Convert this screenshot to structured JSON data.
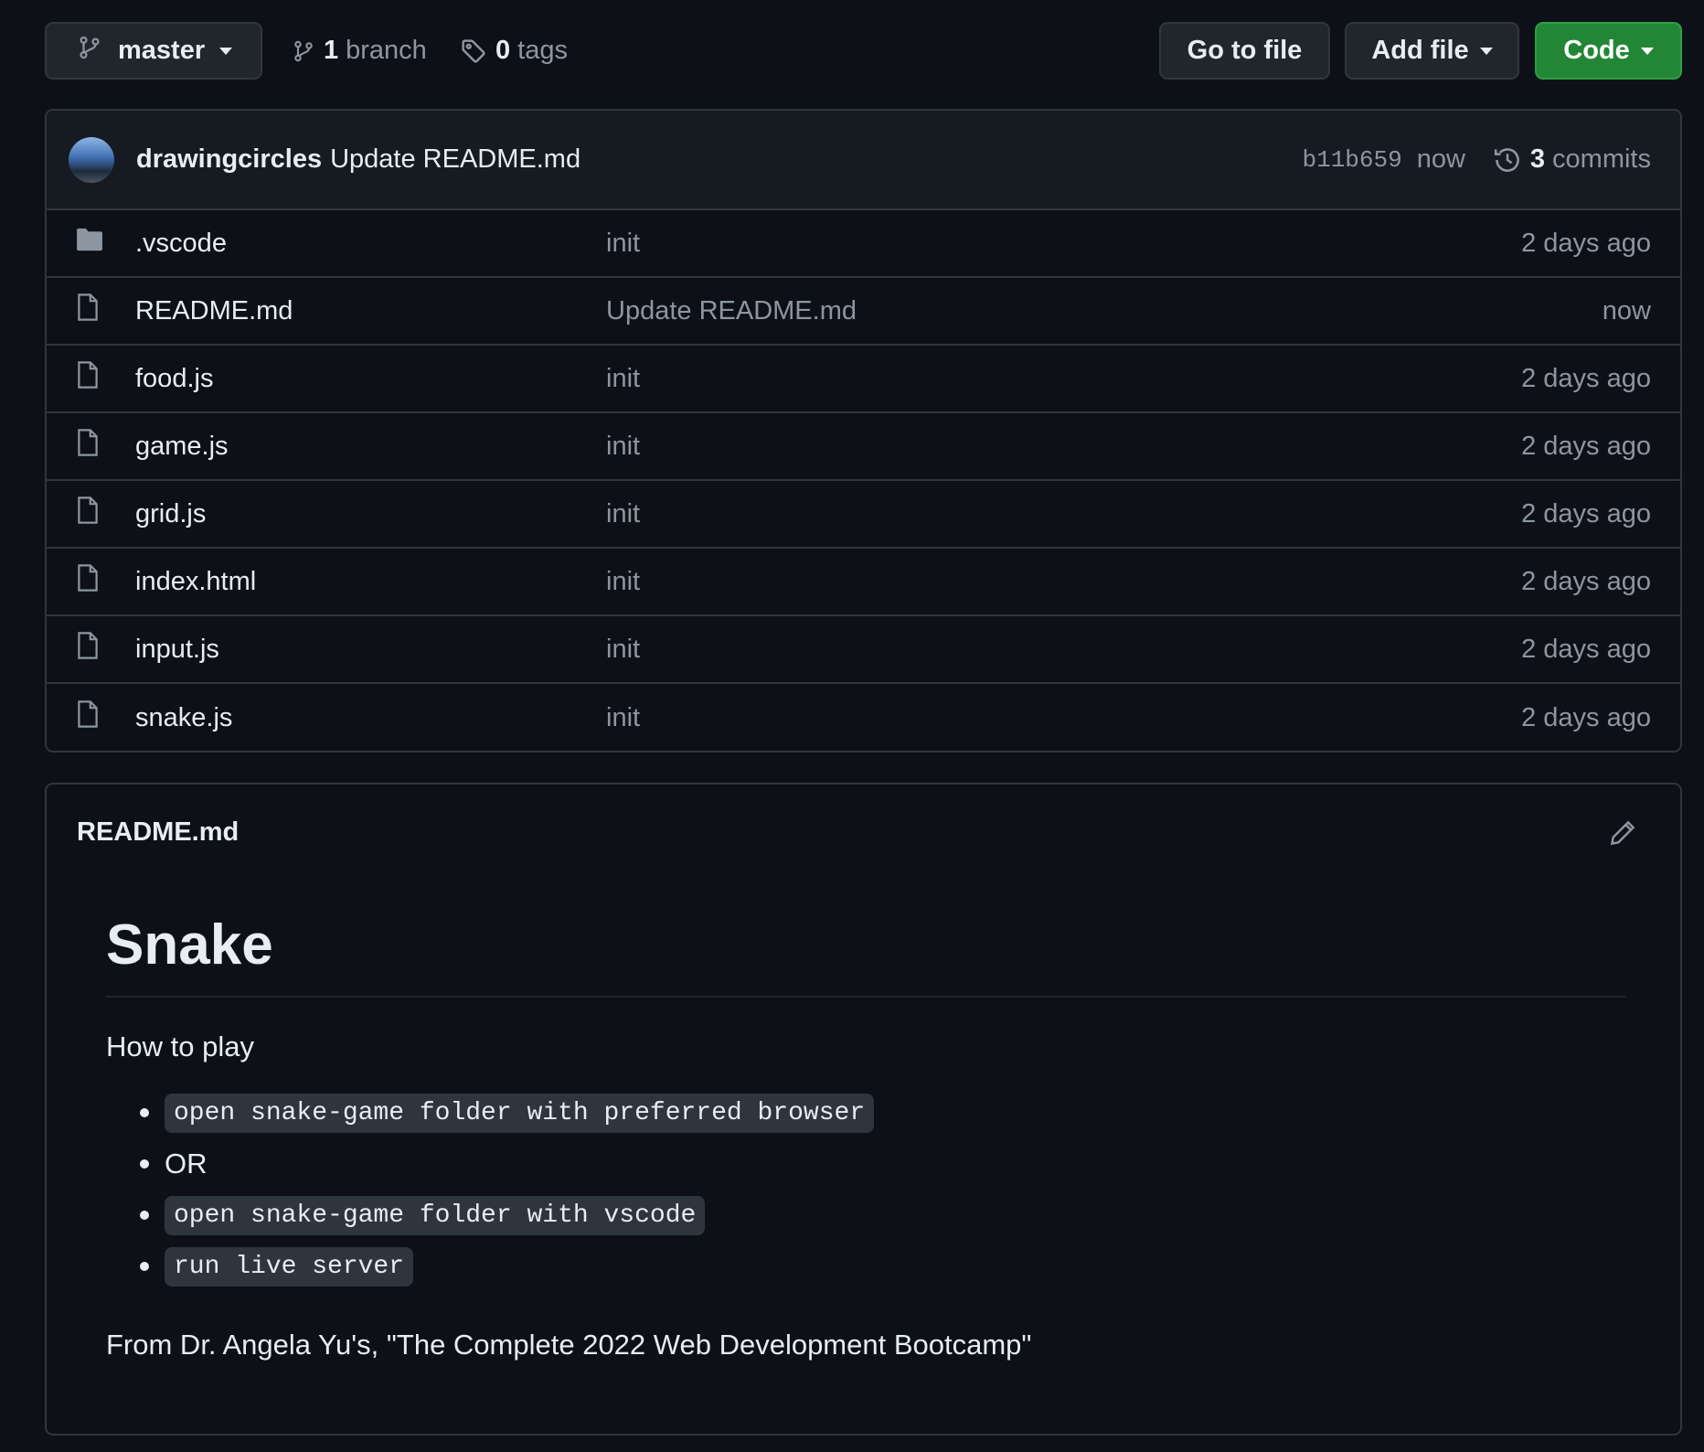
{
  "toolbar": {
    "branch_name": "master",
    "branch_count": "1",
    "branch_label": "branch",
    "tag_count": "0",
    "tag_label": "tags",
    "go_to_file": "Go to file",
    "add_file": "Add file",
    "code": "Code"
  },
  "latest_commit": {
    "author": "drawingcircles",
    "message": "Update README.md",
    "sha": "b11b659",
    "time": "now",
    "commit_count": "3",
    "commit_label": "commits"
  },
  "files": [
    {
      "name": ".vscode",
      "type": "folder",
      "message": "init",
      "age": "2 days ago"
    },
    {
      "name": "README.md",
      "type": "file",
      "message": "Update README.md",
      "age": "now"
    },
    {
      "name": "food.js",
      "type": "file",
      "message": "init",
      "age": "2 days ago"
    },
    {
      "name": "game.js",
      "type": "file",
      "message": "init",
      "age": "2 days ago"
    },
    {
      "name": "grid.js",
      "type": "file",
      "message": "init",
      "age": "2 days ago"
    },
    {
      "name": "index.html",
      "type": "file",
      "message": "init",
      "age": "2 days ago"
    },
    {
      "name": "input.js",
      "type": "file",
      "message": "init",
      "age": "2 days ago"
    },
    {
      "name": "snake.js",
      "type": "file",
      "message": "init",
      "age": "2 days ago"
    }
  ],
  "readme": {
    "filename": "README.md",
    "heading": "Snake",
    "lead": "How to play",
    "items": [
      {
        "text": "open snake-game folder with preferred browser",
        "code": true
      },
      {
        "text": "OR",
        "code": false
      },
      {
        "text": "open snake-game folder with vscode",
        "code": true
      },
      {
        "text": "run live server",
        "code": true
      }
    ],
    "footer": "From Dr. Angela Yu's, \"The Complete 2022 Web Development Bootcamp\""
  },
  "colors": {
    "background": "#0d1117",
    "code_button": "#238636",
    "muted_text": "#8d96a0"
  }
}
